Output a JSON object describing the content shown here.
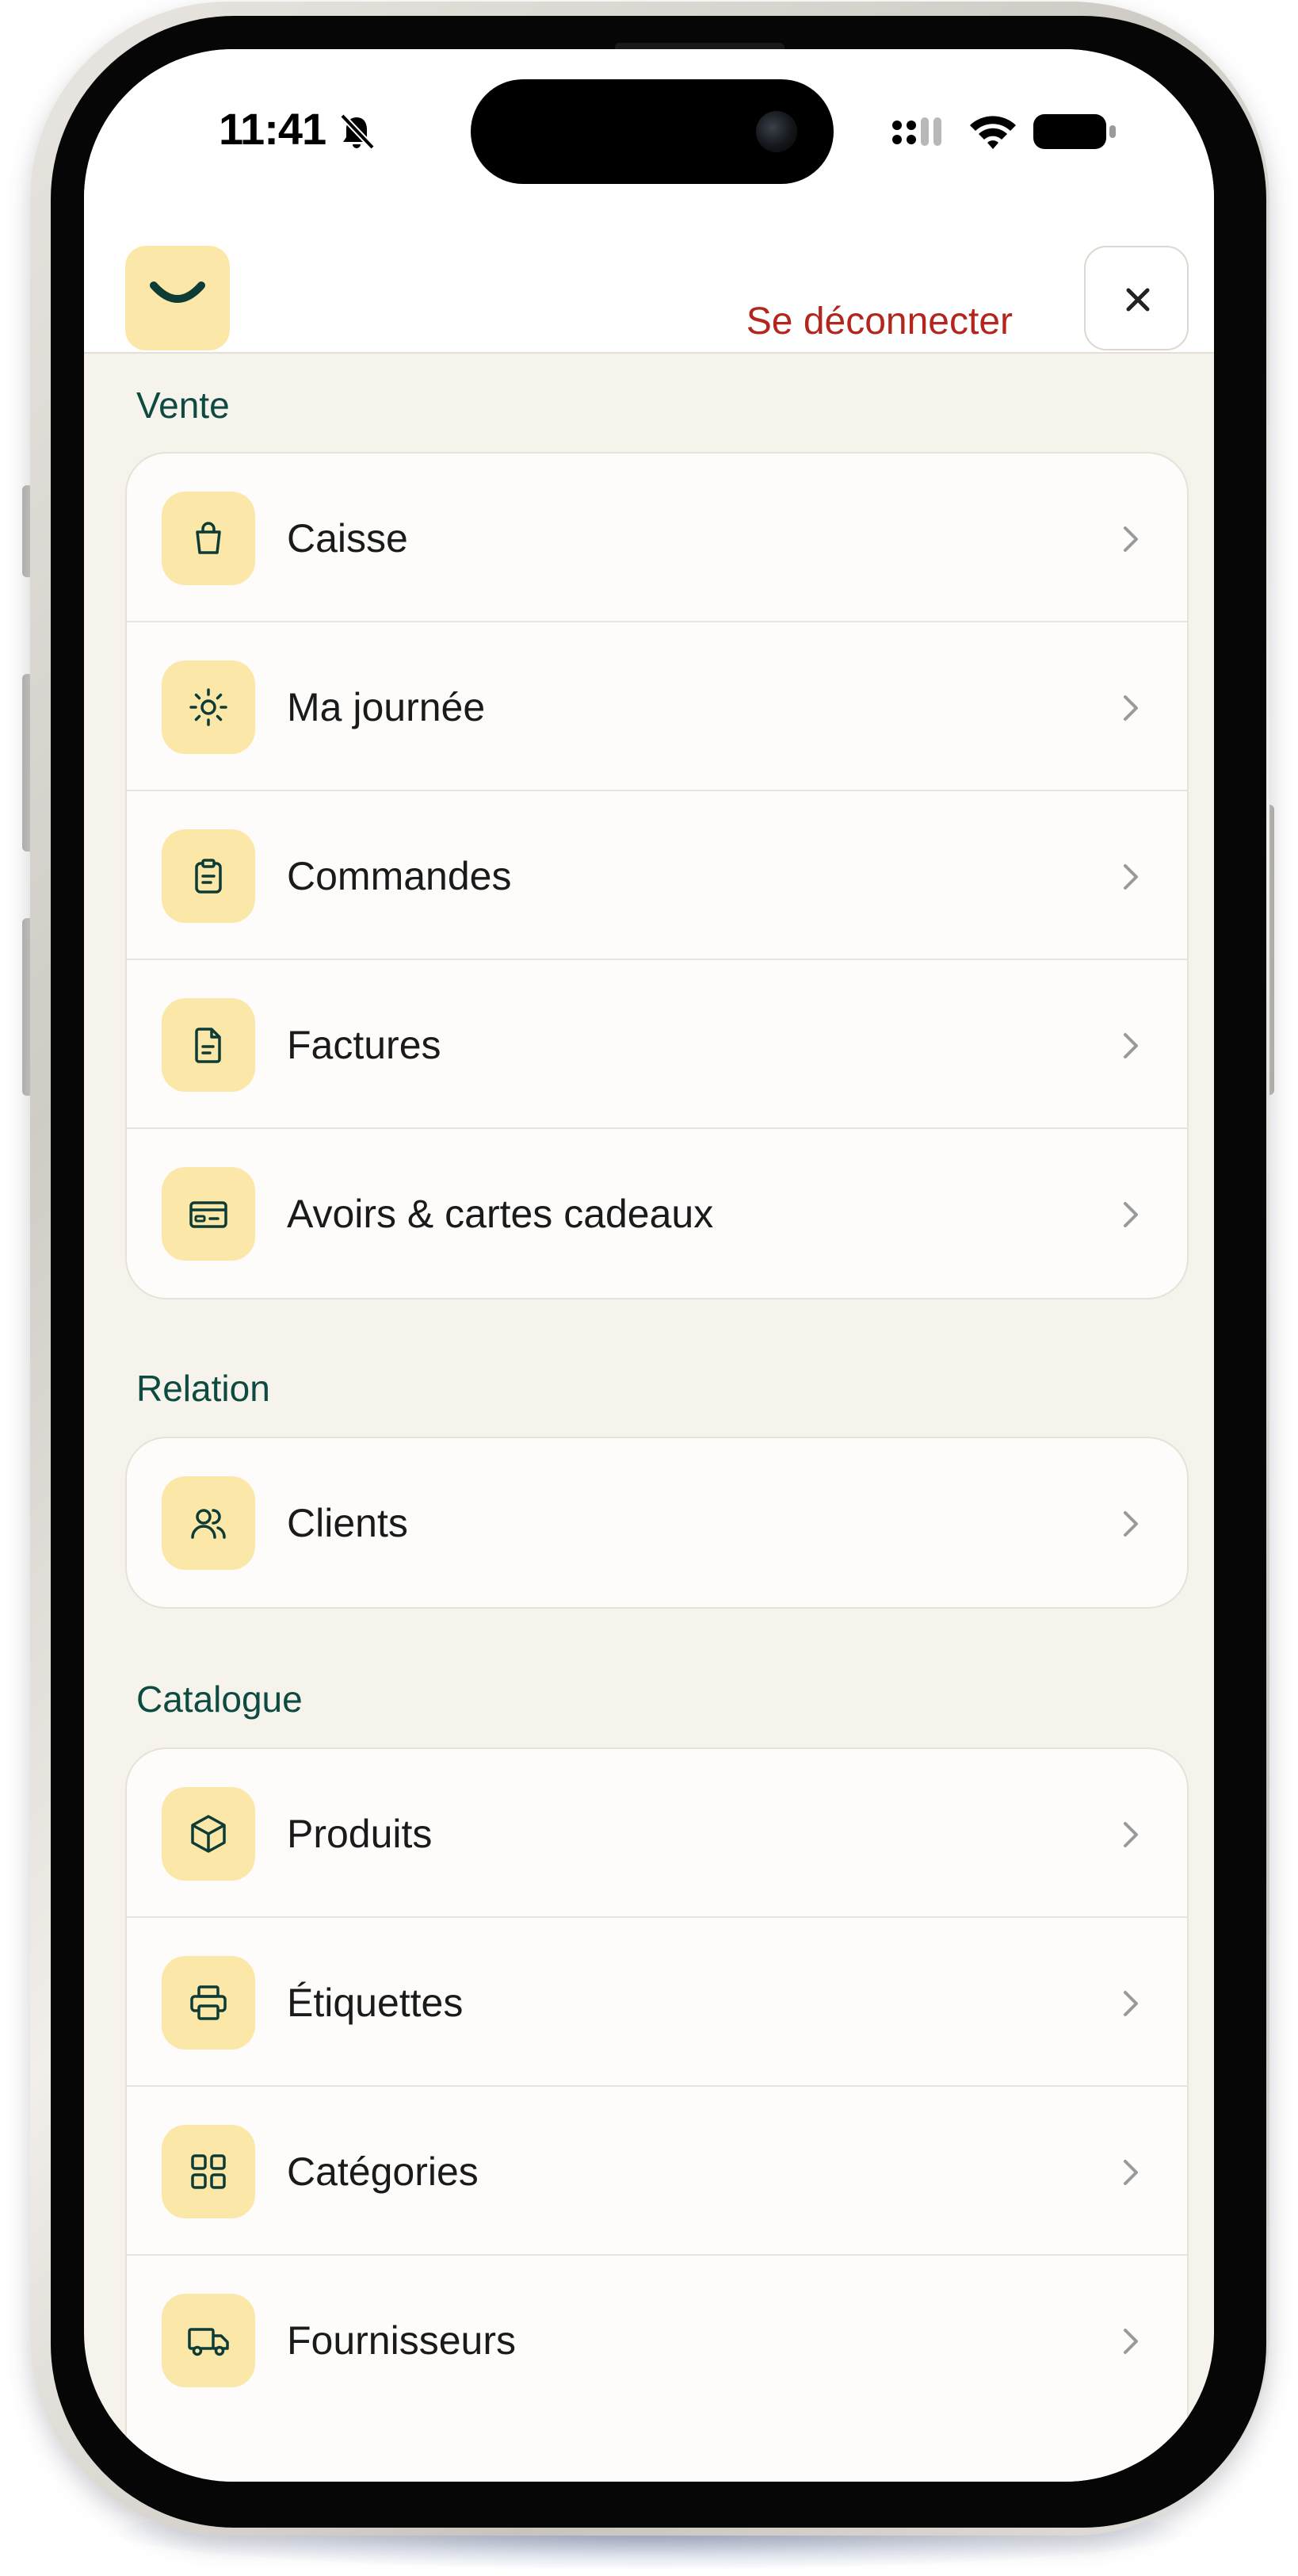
{
  "status_bar": {
    "time": "11:41",
    "icons": [
      "bell-slash-icon",
      "signal-icon",
      "wifi-icon",
      "battery-icon"
    ]
  },
  "header": {
    "logo_icon": "smile-icon",
    "logout_label": "Se déconnecter",
    "close_icon": "close-icon"
  },
  "colors": {
    "accent_red": "#b3261e",
    "section_green": "#0d4a40",
    "icon_bg": "#fbe8a9",
    "page_bg": "#f6f3ec"
  },
  "sections": [
    {
      "title": "Vente",
      "items": [
        {
          "label": "Caisse",
          "icon": "shopping-bag-icon"
        },
        {
          "label": "Ma journée",
          "icon": "sun-icon"
        },
        {
          "label": "Commandes",
          "icon": "clipboard-icon"
        },
        {
          "label": "Factures",
          "icon": "document-icon"
        },
        {
          "label": "Avoirs & cartes cadeaux",
          "icon": "credit-card-icon"
        }
      ]
    },
    {
      "title": "Relation",
      "items": [
        {
          "label": "Clients",
          "icon": "users-icon"
        }
      ]
    },
    {
      "title": "Catalogue",
      "items": [
        {
          "label": "Produits",
          "icon": "box-icon"
        },
        {
          "label": "Étiquettes",
          "icon": "printer-icon"
        },
        {
          "label": "Catégories",
          "icon": "grid-icon"
        },
        {
          "label": "Fournisseurs",
          "icon": "truck-icon"
        }
      ]
    }
  ]
}
